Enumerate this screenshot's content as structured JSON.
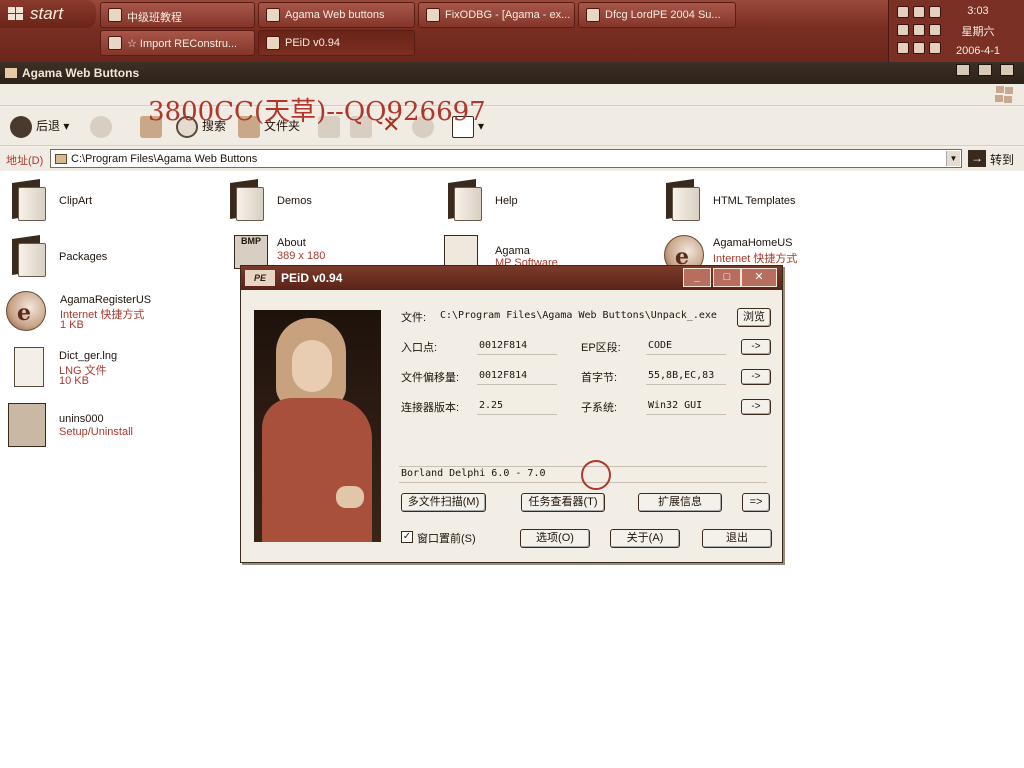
{
  "taskbar": {
    "start_label": "start",
    "buttons_row1": [
      {
        "label": "中级班教程",
        "active": false
      },
      {
        "label": "Agama Web buttons",
        "active": false
      },
      {
        "label": "FixODBG - [Agama - ex...",
        "active": false
      },
      {
        "label": "Dfcg LordPE 2004 Su...",
        "active": false
      }
    ],
    "buttons_row2": [
      {
        "label": "☆ Import REConstru...",
        "active": false
      },
      {
        "label": "PEiD v0.94",
        "active": true
      }
    ],
    "clock": {
      "time": "3:03",
      "day": "星期六",
      "date": "2006-4-1"
    }
  },
  "explorer": {
    "title": "Agama Web Buttons",
    "watermark": "3800CC(天草)--QQ926697",
    "toolbar": {
      "back": "后退",
      "search": "搜索",
      "folders": "文件夹"
    },
    "address_label": "地址(D)",
    "address_value": "C:\\Program Files\\Agama Web Buttons",
    "go_label": "转到",
    "items": {
      "clipart": "ClipArt",
      "demos": "Demos",
      "help": "Help",
      "html_templates": "HTML Templates",
      "packages": "Packages",
      "about_name": "About",
      "about_sub": "389 x 180",
      "agama_name": "Agama",
      "agama_sub": "MP Software",
      "agamahome_name": "AgamaHomeUS",
      "agamahome_sub": "Internet 快捷方式",
      "agamareg_name": "AgamaRegisterUS",
      "agamareg_sub1": "Internet 快捷方式",
      "agamareg_sub2": "1 KB",
      "dict_name": "Dict_ger.lng",
      "dict_sub1": "LNG 文件",
      "dict_sub2": "10 KB",
      "unins_name": "unins000",
      "unins_sub": "Setup/Uninstall"
    }
  },
  "peid": {
    "title": "PEiD v0.94",
    "icon_text": "PE",
    "file_label": "文件:",
    "file_value": "C:\\Program Files\\Agama Web Buttons\\Unpack_.exe",
    "browse": "浏览",
    "entry_label": "入口点:",
    "entry_value": "0012F814",
    "ep_section_label": "EP区段:",
    "ep_section_value": "CODE",
    "offset_label": "文件偏移量:",
    "offset_value": "0012F814",
    "first_bytes_label": "首字节:",
    "first_bytes_value": "55,8B,EC,83",
    "linker_label": "连接器版本:",
    "linker_value": "2.25",
    "subsystem_label": "子系统:",
    "subsystem_value": "Win32 GUI",
    "detected": "Borland Delphi 6.0 - 7.0",
    "arrow": "->",
    "arrow_right": "=>",
    "multi_scan": "多文件扫描(M)",
    "task_viewer": "任务查看器(T)",
    "ext_info": "扩展信息",
    "stay_on_top": "窗口置前(S)",
    "options": "选项(O)",
    "about": "关于(A)",
    "exit": "退出",
    "checkbox_mark": "✓"
  }
}
